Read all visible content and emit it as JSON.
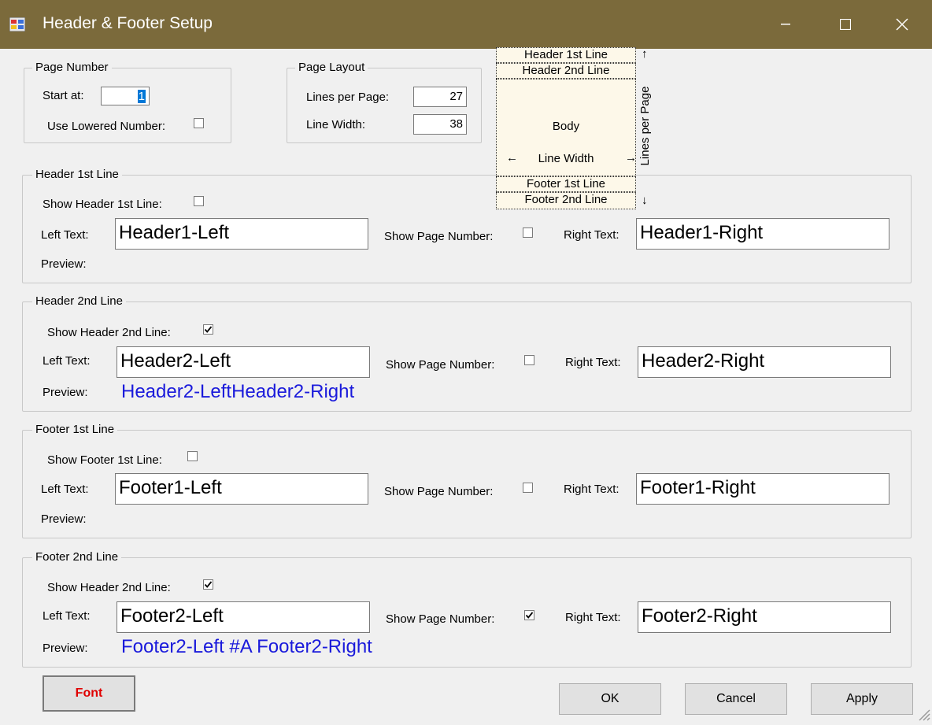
{
  "window": {
    "title": "Header & Footer Setup"
  },
  "page_number": {
    "legend": "Page Number",
    "start_at_label": "Start at:",
    "start_at_value": "1",
    "lowered_label": "Use Lowered Number:",
    "lowered_checked": false
  },
  "page_layout": {
    "legend": "Page Layout",
    "lines_label": "Lines per Page:",
    "lines_value": "27",
    "width_label": "Line Width:",
    "width_value": "38"
  },
  "diagram": {
    "header1": "Header 1st Line",
    "header2": "Header 2nd Line",
    "body": "Body",
    "line_width": "Line Width",
    "footer1": "Footer 1st Line",
    "footer2": "Footer 2nd Line",
    "lines_per_page": "Lines per Page",
    "arrow_up": "↑",
    "arrow_down": "↓",
    "arrow_left": "←",
    "arrow_right": "→"
  },
  "sections": [
    {
      "legend": "Header 1st Line",
      "show_label": "Show Header 1st Line:",
      "show_checked": false,
      "left_label": "Left Text:",
      "left_value": "Header1-Left",
      "page_num_label": "Show Page Number:",
      "page_num_checked": false,
      "right_label": "Right Text:",
      "right_value": "Header1-Right",
      "preview_label": "Preview:",
      "preview_value": ""
    },
    {
      "legend": "Header 2nd Line",
      "show_label": "Show Header 2nd Line:",
      "show_checked": true,
      "left_label": "Left Text:",
      "left_value": "Header2-Left",
      "page_num_label": "Show Page Number:",
      "page_num_checked": false,
      "right_label": "Right Text:",
      "right_value": "Header2-Right",
      "preview_label": "Preview:",
      "preview_value": "Header2-LeftHeader2-Right"
    },
    {
      "legend": "Footer 1st Line",
      "show_label": "Show Footer 1st Line:",
      "show_checked": false,
      "left_label": "Left Text:",
      "left_value": "Footer1-Left",
      "page_num_label": "Show Page Number:",
      "page_num_checked": false,
      "right_label": "Right Text:",
      "right_value": "Footer1-Right",
      "preview_label": "Preview:",
      "preview_value": ""
    },
    {
      "legend": "Footer 2nd Line",
      "show_label": "Show Header 2nd Line:",
      "show_checked": true,
      "left_label": "Left Text:",
      "left_value": "Footer2-Left",
      "page_num_label": "Show Page Number:",
      "page_num_checked": true,
      "right_label": "Right Text:",
      "right_value": "Footer2-Right",
      "preview_label": "Preview:",
      "preview_value": "Footer2-Left #A Footer2-Right"
    }
  ],
  "buttons": {
    "font": "Font",
    "ok": "OK",
    "cancel": "Cancel",
    "apply": "Apply"
  },
  "colors": {
    "titlebar": "#7b6a3b",
    "preview_text": "#1a1adb",
    "font_button_text": "#e00000"
  }
}
